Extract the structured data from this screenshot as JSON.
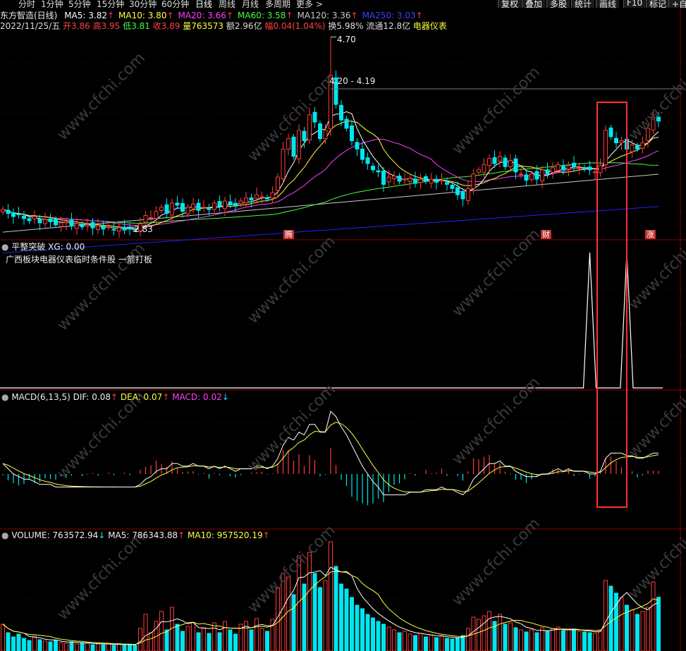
{
  "toolbar": {
    "tabs": [
      "分时",
      "1分钟",
      "5分钟",
      "15分钟",
      "30分钟",
      "60分钟",
      "日线",
      "周线",
      "月线",
      "多周期",
      "更多 >"
    ],
    "active_tab": "日线",
    "right_buttons": [
      "复权",
      "叠加",
      "多股",
      "统计",
      "画线",
      "F10",
      "标记",
      "+自"
    ]
  },
  "main_panel": {
    "stock_name": "东方智造(日线)",
    "ma": [
      {
        "label": "MA5: 3.82",
        "color": "#ffffff",
        "dir": "up"
      },
      {
        "label": "MA10: 3.80",
        "color": "#ffff40",
        "dir": "up"
      },
      {
        "label": "MA20: 3.66",
        "color": "#ff40ff",
        "dir": "up"
      },
      {
        "label": "MA60: 3.58",
        "color": "#40ff40",
        "dir": "up"
      },
      {
        "label": "MA120: 3.36",
        "color": "#c8c8c8",
        "dir": "up"
      },
      {
        "label": "MA250: 3.03",
        "color": "#4040ff",
        "dir": "up"
      }
    ],
    "info": [
      {
        "t": "2022/11/25/五 ",
        "c": "#dddddd"
      },
      {
        "t": "开3.86 ",
        "c": "#ff4040"
      },
      {
        "t": "高3.95 ",
        "c": "#ff4040"
      },
      {
        "t": "低3.81 ",
        "c": "#40ff40"
      },
      {
        "t": "收3.89 ",
        "c": "#ff4040"
      },
      {
        "t": "量763573 ",
        "c": "#ffff40"
      },
      {
        "t": "额2.96亿 ",
        "c": "#dddddd"
      },
      {
        "t": "幅0.04(1.04%) ",
        "c": "#ff4040"
      },
      {
        "t": "换5.98% ",
        "c": "#dddddd"
      },
      {
        "t": "流通12.8亿 ",
        "c": "#dddddd"
      },
      {
        "t": "电器仪表",
        "c": "#ffff40"
      }
    ],
    "high_label": "4.70",
    "range_label": "4.20 - 4.19",
    "low_label": "2.83",
    "badges": [
      "腾",
      "财",
      "涨"
    ]
  },
  "indicator_panel": {
    "title": "平整突破",
    "value": "XG: 0.00",
    "note": "广西板块电器仪表临时条件股 一箭打板"
  },
  "macd_panel": {
    "title": "MACD(6,13,5)",
    "dif": "DIF: 0.08",
    "dea": "DEA: 0.07",
    "macd": "MACD: 0.02"
  },
  "volume_panel": {
    "title": "VOLUME: 763572.94",
    "ma5": "MA5: 786343.88",
    "ma10": "MA10: 957520.19"
  },
  "watermark": "www.cfchi.com",
  "colors": {
    "up": "#ff3b3b",
    "down": "#00e5ee",
    "ma5": "#ffffff",
    "ma10": "#ffff40",
    "ma20": "#ff40ff",
    "ma60": "#40ff40",
    "ma120": "#c8c8c8",
    "ma250": "#2020ff",
    "highlight": "#ff3030",
    "panel_line": "#8b0000"
  },
  "chart_data": {
    "type": "candlestick",
    "days": 125,
    "last_date": "2022/11/25",
    "y_range_price": [
      2.78,
      4.75
    ],
    "closes": [
      3.04,
      3.0,
      2.97,
      2.99,
      2.95,
      2.93,
      2.97,
      2.91,
      2.94,
      2.92,
      2.89,
      2.91,
      2.92,
      2.88,
      2.9,
      2.87,
      2.89,
      2.86,
      2.88,
      2.85,
      2.87,
      2.84,
      2.86,
      2.84,
      2.85,
      2.83,
      2.9,
      2.98,
      2.96,
      3.02,
      3.06,
      3.0,
      3.1,
      3.08,
      3.02,
      3.06,
      3.09,
      3.03,
      3.06,
      3.04,
      3.1,
      3.07,
      3.12,
      3.09,
      3.07,
      3.12,
      3.15,
      3.13,
      3.18,
      3.16,
      3.14,
      3.2,
      3.35,
      3.62,
      3.72,
      3.55,
      3.8,
      3.7,
      3.95,
      3.88,
      3.72,
      3.8,
      4.33,
      4.05,
      3.9,
      3.82,
      3.7,
      3.62,
      3.52,
      3.48,
      3.42,
      3.4,
      3.28,
      3.35,
      3.36,
      3.31,
      3.33,
      3.34,
      3.29,
      3.33,
      3.31,
      3.33,
      3.3,
      3.32,
      3.28,
      3.24,
      3.18,
      3.14,
      3.24,
      3.38,
      3.42,
      3.47,
      3.53,
      3.48,
      3.55,
      3.45,
      3.51,
      3.4,
      3.38,
      3.32,
      3.38,
      3.33,
      3.42,
      3.38,
      3.44,
      3.47,
      3.42,
      3.46,
      3.45,
      3.44,
      3.43,
      3.42,
      3.4,
      3.46,
      3.8,
      3.74,
      3.68,
      3.7,
      3.62,
      3.66,
      3.62,
      3.68,
      3.82,
      3.93,
      3.89
    ],
    "macd_dif": [
      0.04,
      0.02,
      0.0,
      -0.01,
      -0.02,
      -0.02,
      -0.03,
      -0.04,
      -0.04,
      -0.04,
      -0.05,
      -0.05,
      -0.05,
      -0.05,
      -0.05,
      -0.05,
      -0.05,
      -0.05,
      -0.05,
      -0.05,
      -0.05,
      -0.05,
      -0.05,
      -0.05,
      -0.05,
      -0.05,
      -0.04,
      -0.02,
      -0.01,
      0.01,
      0.02,
      0.02,
      0.04,
      0.04,
      0.03,
      0.03,
      0.04,
      0.03,
      0.03,
      0.02,
      0.03,
      0.02,
      0.03,
      0.02,
      0.01,
      0.02,
      0.02,
      0.02,
      0.03,
      0.03,
      0.02,
      0.03,
      0.06,
      0.11,
      0.14,
      0.13,
      0.16,
      0.15,
      0.19,
      0.19,
      0.16,
      0.16,
      0.24,
      0.22,
      0.18,
      0.15,
      0.11,
      0.07,
      0.03,
      0.0,
      -0.03,
      -0.05,
      -0.08,
      -0.08,
      -0.08,
      -0.08,
      -0.08,
      -0.07,
      -0.07,
      -0.07,
      -0.06,
      -0.06,
      -0.06,
      -0.05,
      -0.06,
      -0.06,
      -0.07,
      -0.08,
      -0.06,
      -0.02,
      0.0,
      0.02,
      0.04,
      0.04,
      0.05,
      0.03,
      0.03,
      0.01,
      0.0,
      -0.01,
      -0.01,
      -0.01,
      0.0,
      0.0,
      0.01,
      0.02,
      0.01,
      0.02,
      0.01,
      0.01,
      0.01,
      0.0,
      0.0,
      0.01,
      0.06,
      0.08,
      0.08,
      0.08,
      0.07,
      0.07,
      0.06,
      0.06,
      0.07,
      0.08,
      0.08
    ],
    "volume_max": 1550000,
    "volumes": [
      380000,
      260000,
      200000,
      240000,
      180000,
      150000,
      210000,
      160000,
      140000,
      130000,
      150000,
      120000,
      110000,
      130000,
      100000,
      120000,
      110000,
      90000,
      100000,
      90000,
      110000,
      80000,
      95000,
      85000,
      90000,
      80000,
      320000,
      520000,
      260000,
      420000,
      560000,
      300000,
      620000,
      380000,
      280000,
      350000,
      400000,
      260000,
      330000,
      250000,
      400000,
      260000,
      420000,
      300000,
      240000,
      380000,
      420000,
      300000,
      460000,
      320000,
      280000,
      450000,
      900000,
      1100000,
      1050000,
      800000,
      1350000,
      950000,
      1400000,
      1100000,
      900000,
      1000000,
      1550000,
      1200000,
      950000,
      880000,
      760000,
      650000,
      600000,
      520000,
      470000,
      420000,
      380000,
      340000,
      300000,
      260000,
      280000,
      240000,
      220000,
      250000,
      200000,
      230000,
      190000,
      210000,
      180000,
      170000,
      190000,
      220000,
      320000,
      480000,
      450000,
      500000,
      560000,
      420000,
      520000,
      380000,
      400000,
      330000,
      300000,
      270000,
      300000,
      260000,
      330000,
      280000,
      320000,
      340000,
      290000,
      310000,
      300000,
      280000,
      270000,
      260000,
      250000,
      300000,
      1000000,
      920000,
      820000,
      760000,
      650000,
      580000,
      520000,
      560000,
      620000,
      980000,
      763573
    ],
    "signals": [
      111,
      118
    ]
  }
}
